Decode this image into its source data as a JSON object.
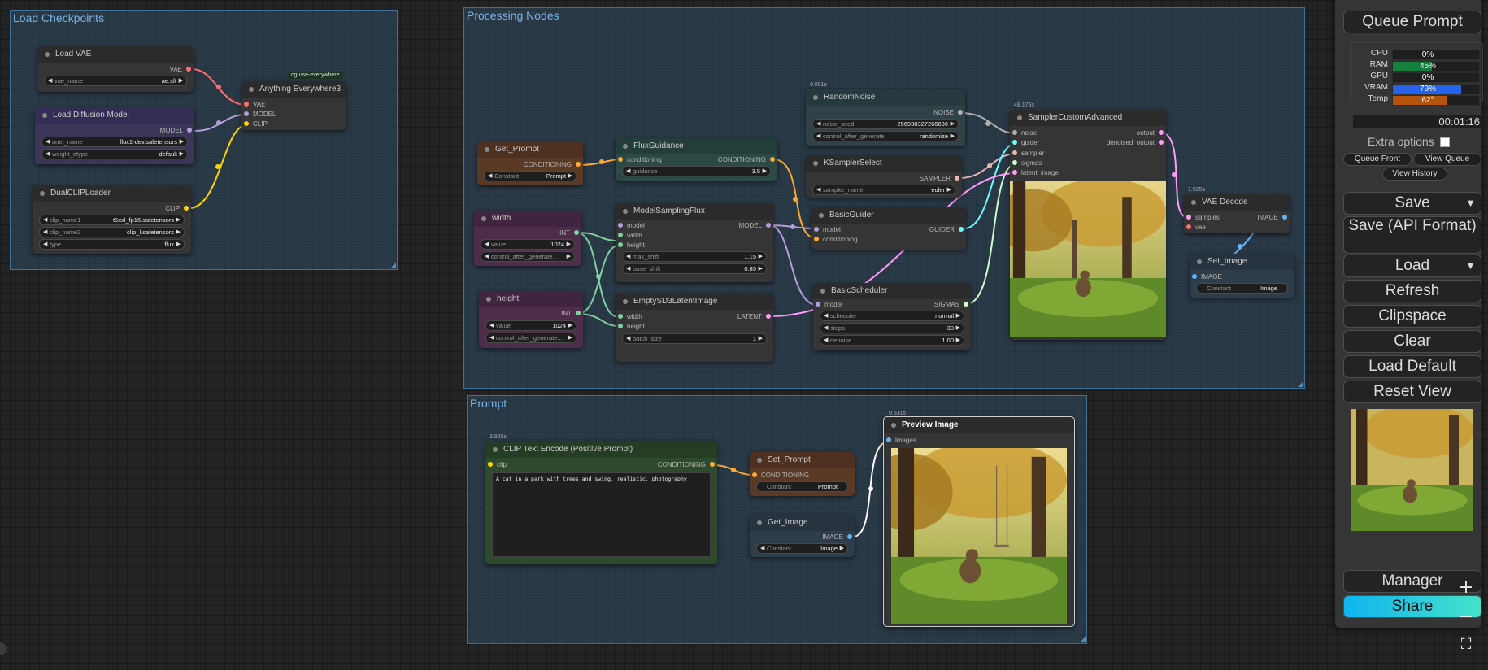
{
  "groups": {
    "load_checkpoints": "Load Checkpoints",
    "processing_nodes": "Processing Nodes",
    "prompt": "Prompt"
  },
  "nodes": {
    "load_vae": {
      "title": "Load VAE",
      "out": "VAE",
      "w_label": "vae_name",
      "w_value": "ae.sft"
    },
    "load_diffusion": {
      "title": "Load Diffusion Model",
      "out": "MODEL",
      "w1_label": "unet_name",
      "w1_value": "flux1-dev.safetensors",
      "w2_label": "weight_dtype",
      "w2_value": "default"
    },
    "dual_clip": {
      "title": "DualCLIPLoader",
      "out": "CLIP",
      "w1_label": "clip_name1",
      "w1_value": "t5xxl_fp16.safetensors",
      "w2_label": "clip_name2",
      "w2_value": "clip_l.safetensors",
      "w3_label": "type",
      "w3_value": "flux"
    },
    "anything_everywhere": {
      "title": "Anything Everywhere3",
      "badge": "cg-use-everywhere",
      "in1": "VAE",
      "in2": "MODEL",
      "in3": "CLIP"
    },
    "get_prompt": {
      "title": "Get_Prompt",
      "out": "CONDITIONING",
      "w_label": "Constant",
      "w_value": "Prompt"
    },
    "width": {
      "title": "width",
      "out": "INT",
      "w1_label": "value",
      "w1_value": "1024",
      "w2_label": "control_after_generate..."
    },
    "height": {
      "title": "height",
      "out": "INT",
      "w1_label": "value",
      "w1_value": "1024",
      "w2_label": "control_after_generate..."
    },
    "flux_guidance": {
      "title": "FluxGuidance",
      "in1": "conditioning",
      "out": "CONDITIONING",
      "w_label": "guidance",
      "w_value": "3.5"
    },
    "model_sampling": {
      "title": "ModelSamplingFlux",
      "in1": "model",
      "in2": "width",
      "in3": "height",
      "out": "MODEL",
      "w1_label": "max_shift",
      "w1_value": "1.15",
      "w2_label": "base_shift",
      "w2_value": "0.85"
    },
    "empty_latent": {
      "title": "EmptySD3LatentImage",
      "in1": "width",
      "in2": "height",
      "out": "LATENT",
      "w_label": "batch_size",
      "w_value": "1"
    },
    "random_noise": {
      "title": "RandomNoise",
      "time": "0.001s",
      "out": "NOISE",
      "w1_label": "noise_seed",
      "w1_value": "256938327266636",
      "w2_label": "control_after_generate",
      "w2_value": "randomize"
    },
    "ksampler_select": {
      "title": "KSamplerSelect",
      "out": "SAMPLER",
      "w_label": "sampler_name",
      "w_value": "euler"
    },
    "basic_guider": {
      "title": "BasicGuider",
      "in1": "model",
      "in2": "conditioning",
      "out": "GUIDER"
    },
    "basic_scheduler": {
      "title": "BasicScheduler",
      "in1": "model",
      "out": "SIGMAS",
      "w1_label": "scheduler",
      "w1_value": "normal",
      "w2_label": "steps",
      "w2_value": "30",
      "w3_label": "denoise",
      "w3_value": "1.00"
    },
    "sampler_custom": {
      "title": "SamplerCustomAdvanced",
      "time": "48.175s",
      "in1": "noise",
      "in2": "guider",
      "in3": "sampler",
      "in4": "sigmas",
      "in5": "latent_image",
      "out1": "output",
      "out2": "denoised_output"
    },
    "vae_decode": {
      "title": "VAE Decode",
      "time": "1.925s",
      "in1": "samples",
      "in2": "vae",
      "out": "IMAGE"
    },
    "set_image": {
      "title": "Set_Image",
      "in1": "IMAGE",
      "w_label": "Constant",
      "w_value": "Image"
    },
    "clip_text": {
      "title": "CLIP Text Encode (Positive Prompt)",
      "time": "3.929s",
      "in1": "clip",
      "out": "CONDITIONING",
      "text": "A cat in a park with trees and swing, realistic, photography"
    },
    "set_prompt": {
      "title": "Set_Prompt",
      "in1": "CONDITIONING",
      "w_label": "Constant",
      "w_value": "Prompt"
    },
    "get_image": {
      "title": "Get_Image",
      "out": "IMAGE",
      "w_label": "Constant",
      "w_value": "Image"
    },
    "preview_image": {
      "title": "Preview Image",
      "time": "0.531s",
      "in1": "images"
    }
  },
  "menu": {
    "queue_prompt": "Queue Prompt",
    "monitor": [
      {
        "label": "CPU",
        "value": "0%",
        "level": 0,
        "color": "#16a34a"
      },
      {
        "label": "RAM",
        "value": "45%",
        "level": 45,
        "color": "#15803d"
      },
      {
        "label": "GPU",
        "value": "0%",
        "level": 0,
        "color": "#16a34a"
      },
      {
        "label": "VRAM",
        "value": "79%",
        "level": 79,
        "color": "#2563eb"
      },
      {
        "label": "Temp",
        "value": "62°",
        "level": 62,
        "color": "#b45309"
      }
    ],
    "timer": "00:01:16",
    "extra_options": "Extra options",
    "queue_front": "Queue Front",
    "view_queue": "View Queue",
    "view_history": "View History",
    "save": "Save",
    "save_api": "Save (API Format)",
    "load": "Load",
    "refresh": "Refresh",
    "clipspace": "Clipspace",
    "clear": "Clear",
    "load_default": "Load Default",
    "reset_view": "Reset View",
    "manager": "Manager",
    "share": "Share",
    "dropdown_arrow": "▼"
  },
  "zoom": {
    "plus": "+",
    "minus": "−",
    "fit": "⛶"
  },
  "colors": {
    "vae": "#ff6e6e",
    "model": "#b39ddb",
    "clip": "#ffd500",
    "conditioning": "#ffa931",
    "int": "#7fd1a4",
    "latent": "#ff9cf9",
    "noise": "#b0b0b0",
    "sampler": "#ecb4b4",
    "guider": "#66ffff",
    "sigmas": "#cdffcd",
    "image": "#64b5f6"
  }
}
